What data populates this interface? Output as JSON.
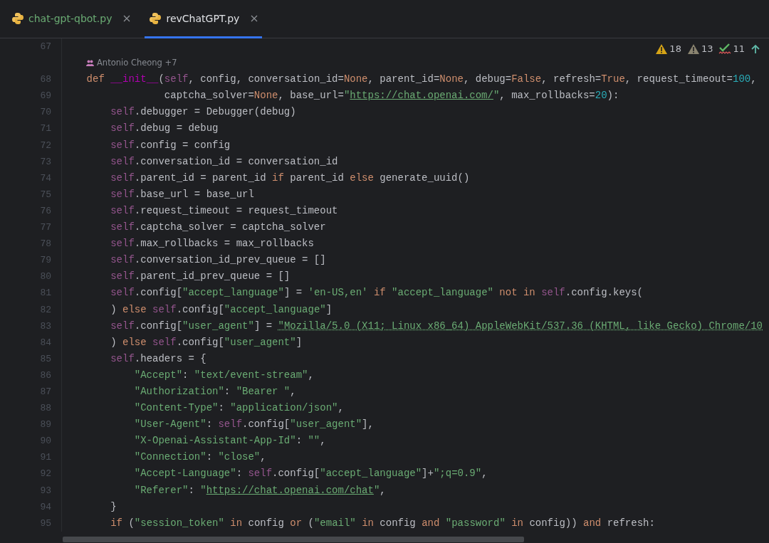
{
  "tabs": [
    {
      "label": "chat-gpt-qbot.py",
      "color": "#6aab73",
      "selected": false
    },
    {
      "label": "revChatGPT.py",
      "color": "#dfe1e5",
      "selected": true
    }
  ],
  "inspections": [
    {
      "kind": "warning",
      "count": "18"
    },
    {
      "kind": "weak_warning",
      "count": "13"
    },
    {
      "kind": "typo",
      "count": "11"
    }
  ],
  "lines": [
    {
      "kind": "code",
      "number": "67"
    },
    {
      "kind": "author_hint",
      "text": "Antonio Cheong +7"
    },
    {
      "kind": "code",
      "number": "68",
      "tokens": [
        {
          "kind": "keyword",
          "text": "    def "
        },
        {
          "kind": "dunder",
          "text": "__init__"
        },
        {
          "kind": "plain",
          "text": "("
        },
        {
          "kind": "self",
          "text": "self"
        },
        {
          "kind": "plain",
          "text": ", config, conversation_id="
        },
        {
          "kind": "keyword",
          "text": "None"
        },
        {
          "kind": "plain",
          "text": ", parent_id="
        },
        {
          "kind": "keyword",
          "text": "None"
        },
        {
          "kind": "plain",
          "text": ", debug="
        },
        {
          "kind": "keyword",
          "text": "False"
        },
        {
          "kind": "plain",
          "text": ", refresh="
        },
        {
          "kind": "keyword",
          "text": "True"
        },
        {
          "kind": "plain",
          "text": ", request_timeout="
        },
        {
          "kind": "number",
          "text": "100"
        },
        {
          "kind": "plain",
          "text": ","
        }
      ]
    },
    {
      "kind": "code",
      "number": "69",
      "tokens": [
        {
          "kind": "plain",
          "text": "                 captcha_solver="
        },
        {
          "kind": "keyword",
          "text": "None"
        },
        {
          "kind": "plain",
          "text": ", base_url="
        },
        {
          "kind": "string",
          "text": "\""
        },
        {
          "kind": "url",
          "text": "https://chat.openai.com/"
        },
        {
          "kind": "string",
          "text": "\""
        },
        {
          "kind": "plain",
          "text": ", max_rollbacks="
        },
        {
          "kind": "number",
          "text": "20"
        },
        {
          "kind": "plain",
          "text": "):"
        }
      ]
    },
    {
      "kind": "code",
      "number": "70",
      "tokens": [
        {
          "kind": "self",
          "text": "        self"
        },
        {
          "kind": "plain",
          "text": ".debugger = Debugger(debug)"
        }
      ]
    },
    {
      "kind": "code",
      "number": "71",
      "tokens": [
        {
          "kind": "self",
          "text": "        self"
        },
        {
          "kind": "plain",
          "text": ".debug = debug"
        }
      ]
    },
    {
      "kind": "code",
      "number": "72",
      "tokens": [
        {
          "kind": "self",
          "text": "        self"
        },
        {
          "kind": "plain",
          "text": ".config = config"
        }
      ]
    },
    {
      "kind": "code",
      "number": "73",
      "tokens": [
        {
          "kind": "self",
          "text": "        self"
        },
        {
          "kind": "plain",
          "text": ".conversation_id = conversation_id"
        }
      ]
    },
    {
      "kind": "code",
      "number": "74",
      "tokens": [
        {
          "kind": "self",
          "text": "        self"
        },
        {
          "kind": "plain",
          "text": ".parent_id = parent_id "
        },
        {
          "kind": "keyword",
          "text": "if"
        },
        {
          "kind": "plain",
          "text": " parent_id "
        },
        {
          "kind": "keyword",
          "text": "else"
        },
        {
          "kind": "plain",
          "text": " generate_uuid()"
        }
      ]
    },
    {
      "kind": "code",
      "number": "75",
      "tokens": [
        {
          "kind": "self",
          "text": "        self"
        },
        {
          "kind": "plain",
          "text": ".base_url = base_url"
        }
      ]
    },
    {
      "kind": "code",
      "number": "76",
      "tokens": [
        {
          "kind": "self",
          "text": "        self"
        },
        {
          "kind": "plain",
          "text": ".request_timeout = request_timeout"
        }
      ]
    },
    {
      "kind": "code",
      "number": "77",
      "tokens": [
        {
          "kind": "self",
          "text": "        self"
        },
        {
          "kind": "plain",
          "text": ".captcha_solver = captcha_solver"
        }
      ]
    },
    {
      "kind": "code",
      "number": "78",
      "tokens": [
        {
          "kind": "self",
          "text": "        self"
        },
        {
          "kind": "plain",
          "text": ".max_rollbacks = max_rollbacks"
        }
      ]
    },
    {
      "kind": "code",
      "number": "79",
      "tokens": [
        {
          "kind": "self",
          "text": "        self"
        },
        {
          "kind": "plain",
          "text": ".conversation_id_prev_queue = []"
        }
      ]
    },
    {
      "kind": "code",
      "number": "80",
      "tokens": [
        {
          "kind": "self",
          "text": "        self"
        },
        {
          "kind": "plain",
          "text": ".parent_id_prev_queue = []"
        }
      ]
    },
    {
      "kind": "code",
      "number": "81",
      "tokens": [
        {
          "kind": "self",
          "text": "        self"
        },
        {
          "kind": "plain",
          "text": ".config["
        },
        {
          "kind": "string",
          "text": "\"accept_language\""
        },
        {
          "kind": "plain",
          "text": "] = "
        },
        {
          "kind": "string",
          "text": "'en-US,en'"
        },
        {
          "kind": "keyword",
          "text": " if "
        },
        {
          "kind": "string",
          "text": "\"accept_language\""
        },
        {
          "kind": "keyword",
          "text": " not in "
        },
        {
          "kind": "self",
          "text": "self"
        },
        {
          "kind": "plain",
          "text": ".config.keys("
        }
      ]
    },
    {
      "kind": "code",
      "number": "82",
      "tokens": [
        {
          "kind": "plain",
          "text": "        ) "
        },
        {
          "kind": "keyword",
          "text": "else "
        },
        {
          "kind": "self",
          "text": "self"
        },
        {
          "kind": "plain",
          "text": ".config["
        },
        {
          "kind": "string",
          "text": "\"accept_language\""
        },
        {
          "kind": "plain",
          "text": "]"
        }
      ]
    },
    {
      "kind": "code",
      "number": "83",
      "tokens": [
        {
          "kind": "self",
          "text": "        self"
        },
        {
          "kind": "plain",
          "text": ".config["
        },
        {
          "kind": "string",
          "text": "\"user_agent\""
        },
        {
          "kind": "plain",
          "text": "] = "
        },
        {
          "kind": "typo",
          "text": "\"Mozilla/5.0 (X11; Linux x86_64) AppleWebKit/537.36 (KHTML, like Gecko) Chrome/10"
        }
      ]
    },
    {
      "kind": "code",
      "number": "84",
      "tokens": [
        {
          "kind": "plain",
          "text": "        ) "
        },
        {
          "kind": "keyword",
          "text": "else "
        },
        {
          "kind": "self",
          "text": "self"
        },
        {
          "kind": "plain",
          "text": ".config["
        },
        {
          "kind": "string",
          "text": "\"user_agent\""
        },
        {
          "kind": "plain",
          "text": "]"
        }
      ]
    },
    {
      "kind": "code",
      "number": "85",
      "tokens": [
        {
          "kind": "self",
          "text": "        self"
        },
        {
          "kind": "plain",
          "text": ".headers = {"
        }
      ]
    },
    {
      "kind": "code",
      "number": "86",
      "tokens": [
        {
          "kind": "string",
          "text": "            \"Accept\""
        },
        {
          "kind": "plain",
          "text": ": "
        },
        {
          "kind": "string",
          "text": "\"text/event-stream\""
        },
        {
          "kind": "plain",
          "text": ","
        }
      ]
    },
    {
      "kind": "code",
      "number": "87",
      "tokens": [
        {
          "kind": "string",
          "text": "            \"Authorization\""
        },
        {
          "kind": "plain",
          "text": ": "
        },
        {
          "kind": "string",
          "text": "\"Bearer \""
        },
        {
          "kind": "plain",
          "text": ","
        }
      ]
    },
    {
      "kind": "code",
      "number": "88",
      "tokens": [
        {
          "kind": "string",
          "text": "            \"Content-Type\""
        },
        {
          "kind": "plain",
          "text": ": "
        },
        {
          "kind": "string",
          "text": "\"application/json\""
        },
        {
          "kind": "plain",
          "text": ","
        }
      ]
    },
    {
      "kind": "code",
      "number": "89",
      "tokens": [
        {
          "kind": "string",
          "text": "            \"User-Agent\""
        },
        {
          "kind": "plain",
          "text": ": "
        },
        {
          "kind": "self",
          "text": "self"
        },
        {
          "kind": "plain",
          "text": ".config["
        },
        {
          "kind": "string",
          "text": "\"user_agent\""
        },
        {
          "kind": "plain",
          "text": "],"
        }
      ]
    },
    {
      "kind": "code",
      "number": "90",
      "tokens": [
        {
          "kind": "string",
          "text": "            \"X-Openai-Assistant-App-Id\""
        },
        {
          "kind": "plain",
          "text": ": "
        },
        {
          "kind": "string",
          "text": "\"\""
        },
        {
          "kind": "plain",
          "text": ","
        }
      ]
    },
    {
      "kind": "code",
      "number": "91",
      "tokens": [
        {
          "kind": "string",
          "text": "            \"Connection\""
        },
        {
          "kind": "plain",
          "text": ": "
        },
        {
          "kind": "string",
          "text": "\"close\""
        },
        {
          "kind": "plain",
          "text": ","
        }
      ]
    },
    {
      "kind": "code",
      "number": "92",
      "tokens": [
        {
          "kind": "string",
          "text": "            \"Accept-Language\""
        },
        {
          "kind": "plain",
          "text": ": "
        },
        {
          "kind": "self",
          "text": "self"
        },
        {
          "kind": "plain",
          "text": ".config["
        },
        {
          "kind": "string",
          "text": "\"accept_language\""
        },
        {
          "kind": "plain",
          "text": "]+"
        },
        {
          "kind": "string",
          "text": "\";q=0.9\""
        },
        {
          "kind": "plain",
          "text": ","
        }
      ]
    },
    {
      "kind": "code",
      "number": "93",
      "tokens": [
        {
          "kind": "string",
          "text": "            \"Referer\""
        },
        {
          "kind": "plain",
          "text": ": "
        },
        {
          "kind": "string",
          "text": "\""
        },
        {
          "kind": "url",
          "text": "https://chat.openai.com/chat"
        },
        {
          "kind": "string",
          "text": "\""
        },
        {
          "kind": "plain",
          "text": ","
        }
      ]
    },
    {
      "kind": "code",
      "number": "94",
      "tokens": [
        {
          "kind": "plain",
          "text": "        }"
        }
      ]
    },
    {
      "kind": "code",
      "number": "95",
      "tokens": [
        {
          "kind": "keyword",
          "text": "        if"
        },
        {
          "kind": "plain",
          "text": " ("
        },
        {
          "kind": "string",
          "text": "\"session_token\""
        },
        {
          "kind": "keyword",
          "text": " in"
        },
        {
          "kind": "plain",
          "text": " config "
        },
        {
          "kind": "keyword",
          "text": "or"
        },
        {
          "kind": "plain",
          "text": " ("
        },
        {
          "kind": "string",
          "text": "\"email\""
        },
        {
          "kind": "keyword",
          "text": " in"
        },
        {
          "kind": "plain",
          "text": " config "
        },
        {
          "kind": "keyword",
          "text": "and "
        },
        {
          "kind": "string",
          "text": "\"password\""
        },
        {
          "kind": "keyword",
          "text": " in"
        },
        {
          "kind": "plain",
          "text": " config)) "
        },
        {
          "kind": "keyword",
          "text": "and"
        },
        {
          "kind": "plain",
          "text": " refresh:"
        }
      ]
    }
  ]
}
